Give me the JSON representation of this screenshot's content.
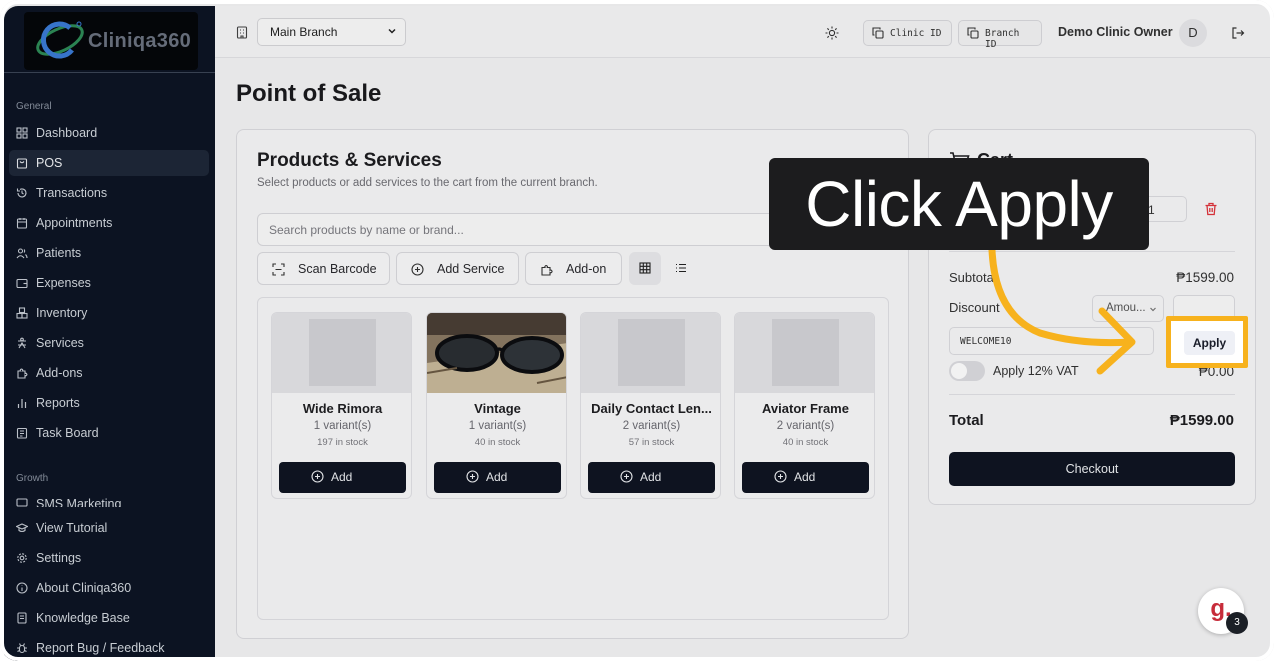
{
  "sidebar": {
    "logo_text": "Cliniqa360",
    "section_general": "General",
    "section_growth": "Growth",
    "items": [
      {
        "label": "Dashboard"
      },
      {
        "label": "POS"
      },
      {
        "label": "Transactions"
      },
      {
        "label": "Appointments"
      },
      {
        "label": "Patients"
      },
      {
        "label": "Expenses"
      },
      {
        "label": "Inventory"
      },
      {
        "label": "Services"
      },
      {
        "label": "Add-ons"
      },
      {
        "label": "Reports"
      },
      {
        "label": "Task Board"
      }
    ],
    "growth_items": [
      {
        "label": "SMS Marketing"
      }
    ],
    "footer_items": [
      {
        "label": "View Tutorial"
      },
      {
        "label": "Settings"
      },
      {
        "label": "About Cliniqa360"
      },
      {
        "label": "Knowledge Base"
      },
      {
        "label": "Report Bug / Feedback"
      }
    ]
  },
  "topbar": {
    "branch": "Main Branch",
    "clinic_id": "Clinic ID",
    "branch_id": "Branch ID",
    "owner": "Demo Clinic Owner",
    "avatar_initial": "D"
  },
  "page_title": "Point of Sale",
  "products": {
    "title": "Products & Services",
    "subtitle": "Select products or add services to the cart from the current branch.",
    "search_placeholder": "Search products by name or brand...",
    "scan_label": "Scan Barcode",
    "add_service_label": "Add Service",
    "addon_label": "Add-on",
    "items": [
      {
        "name": "Wide Rimora",
        "variants": "1 variant(s)",
        "stock": "197 in stock",
        "add": "Add"
      },
      {
        "name": "Vintage",
        "variants": "1 variant(s)",
        "stock": "40 in stock",
        "add": "Add"
      },
      {
        "name": "Daily Contact Len...",
        "variants": "2 variant(s)",
        "stock": "57 in stock",
        "add": "Add"
      },
      {
        "name": "Aviator Frame",
        "variants": "2 variant(s)",
        "stock": "40 in stock",
        "add": "Add"
      }
    ]
  },
  "cart": {
    "title": "Cart",
    "qty": "1",
    "subtotal_label": "Subtotal",
    "subtotal_value": "₱1599.00",
    "discount_label": "Discount",
    "discount_type": "Amou...",
    "code": "WELCOME10",
    "apply_label": "Apply",
    "vat_label": "Apply 12% VAT",
    "vat_value": "₱0.00",
    "total_label": "Total",
    "total_value": "₱1599.00",
    "checkout_label": "Checkout"
  },
  "callout": "Click Apply",
  "chat": {
    "glyph": "g.",
    "badge": "3"
  },
  "colors": {
    "sidebar_bg": "#0d1524",
    "primary_button": "#0f1522",
    "highlight": "#f7b21d",
    "danger": "#e0353d"
  }
}
